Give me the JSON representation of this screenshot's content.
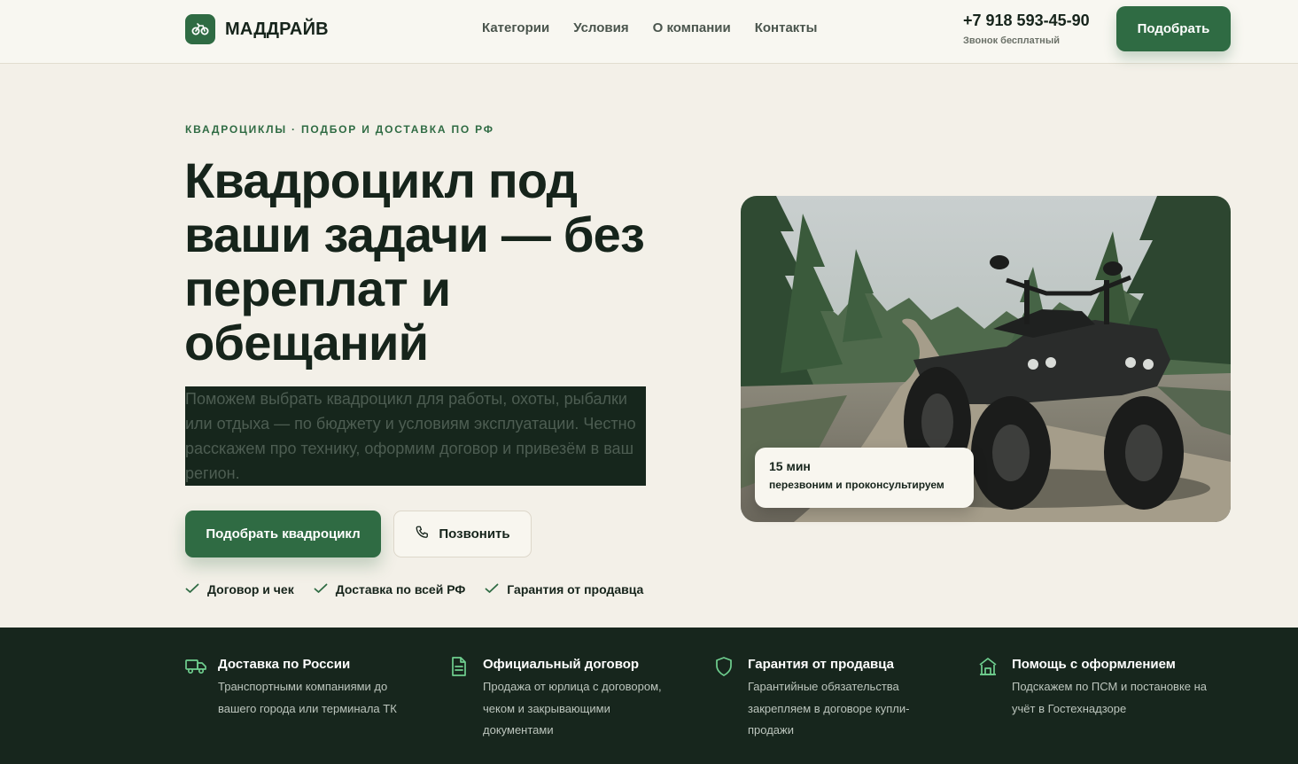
{
  "header": {
    "logo_text": "МАДДРАЙВ",
    "nav": [
      "Категории",
      "Условия",
      "О компании",
      "Контакты"
    ],
    "phone": "+7 918 593-45-90",
    "phone_note": "Звонок бесплатный",
    "cta_label": "Подобрать"
  },
  "hero": {
    "eyebrow": "КВАДРОЦИКЛЫ · ПОДБОР И ДОСТАВКА ПО РФ",
    "title": "Квадроцикл под ваши задачи — без переплат и обещаний",
    "description": "Поможем выбрать квадроцикл для работы, охоты, рыбалки или отдыха — по бюджету и условиям эксплуатации. Честно расскажем про технику, оформим договор и привезём в ваш регион.",
    "primary_button": "Подобрать квадроцикл",
    "call_button": "Позвонить",
    "checks": [
      "Договор и чек",
      "Доставка по всей РФ",
      "Гарантия от продавца"
    ],
    "callout": {
      "value": "15 мин",
      "text": "перезвоним и проконсультируем"
    }
  },
  "features": [
    {
      "icon": "truck-icon",
      "title": "Доставка по России",
      "text": "Транспортными компаниями до вашего города или терминала ТК"
    },
    {
      "icon": "document-icon",
      "title": "Официальный договор",
      "text": "Продажа от юрлица с договором, чеком и закрывающими документами"
    },
    {
      "icon": "shield-icon",
      "title": "Гарантия от продавца",
      "text": "Гарантийные обязательства закрепляем в договоре купли-продажи"
    },
    {
      "icon": "building-icon",
      "title": "Помощь с оформлением",
      "text": "Подскажем по ПСМ и постановке на учёт в Гостехнадзоре"
    }
  ],
  "colors": {
    "accent": "#2f6b43",
    "page_background": "#f3f0e8",
    "dark_band": "#17261d",
    "feature_icon": "#6fcf8f"
  }
}
